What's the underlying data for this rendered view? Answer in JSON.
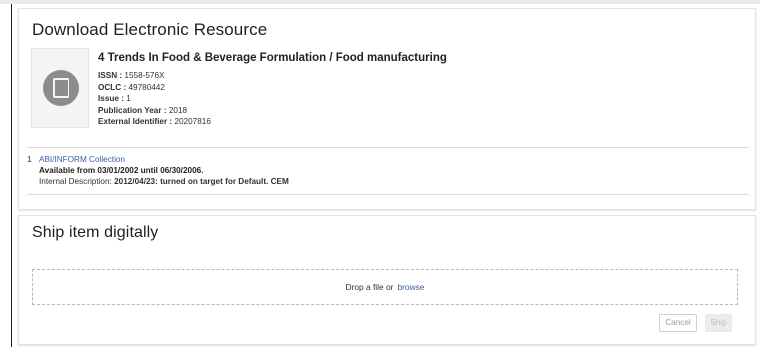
{
  "download_panel": {
    "title": "Download Electronic Resource",
    "resource": {
      "title": "4 Trends In Food & Beverage Formulation / Food manufacturing",
      "issn_label": "ISSN :",
      "issn_value": "1558-576X",
      "oclc_label": "OCLC :",
      "oclc_value": "49780442",
      "issue_label": "Issue :",
      "issue_value": "1",
      "pubyear_label": "Publication Year :",
      "pubyear_value": "2018",
      "extid_label": "External Identifier :",
      "extid_value": "20207816",
      "thumbnail_icon": "book-icon"
    },
    "service": {
      "number": "1",
      "collection_link": "ABI/INFORM Collection",
      "availability": "Available from 03/01/2002 until 06/30/2006.",
      "internal_label": "Internal Description:",
      "internal_value": "2012/04/23: turned on target for Default. CEM"
    }
  },
  "ship_panel": {
    "title": "Ship item digitally",
    "dropzone_text": "Drop a file or",
    "browse_link": "browse",
    "cancel_label": "Cancel",
    "ship_label": "Ship"
  },
  "colors": {
    "link": "#3a5fa6",
    "thumbnail_bg": "#f4f4f4",
    "icon_gray": "#8c8c8c"
  }
}
